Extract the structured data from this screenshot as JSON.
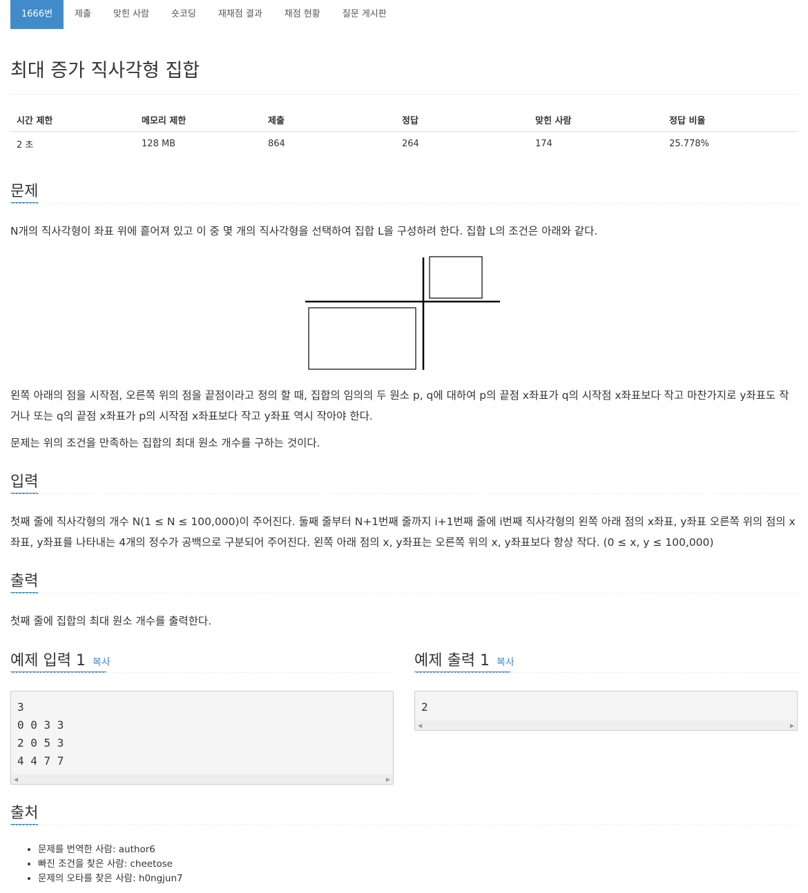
{
  "tabs": [
    {
      "label": "1666번",
      "active": true
    },
    {
      "label": "제출"
    },
    {
      "label": "맞힌 사람"
    },
    {
      "label": "숏코딩"
    },
    {
      "label": "재채점 결과"
    },
    {
      "label": "채점 현황"
    },
    {
      "label": "질문 게시판"
    }
  ],
  "problem_title": "최대 증가 직사각형 집합",
  "info": {
    "headers": [
      "시간 제한",
      "메모리 제한",
      "제출",
      "정답",
      "맞힌 사람",
      "정답 비율"
    ],
    "values": [
      "2 초",
      "128 MB",
      "864",
      "264",
      "174",
      "25.778%"
    ]
  },
  "sections": {
    "problem": {
      "heading": "문제",
      "p1": "N개의 직사각형이 좌표 위에 흩어져 있고 이 중 몇 개의 직사각형을 선택하여 집합 L을 구성하려 한다. 집합 L의 조건은 아래와 같다.",
      "p2": "왼쪽 아래의 점을 시작점, 오른쪽 위의 점을 끝점이라고 정의 할 때, 집합의 임의의 두 원소 p, q에 대하여 p의 끝점 x좌표가 q의 시작점 x좌표보다 작고 마찬가지로 y좌표도 작거나 또는 q의 끝점 x좌표가 p의 시작점 x좌표보다 작고 y좌표 역시 작아야 한다.",
      "p3": "문제는 위의 조건을 만족하는 집합의 최대 원소 개수를 구하는 것이다."
    },
    "input": {
      "heading": "입력",
      "text": "첫째 줄에 직사각형의 개수 N(1 ≤ N ≤ 100,000)이 주어진다. 둘째 줄부터 N+1번째 줄까지 i+1번째 줄에 i번째 직사각형의 왼쪽 아래 점의 x좌표, y좌표 오른쪽 위의 점의 x좌표, y좌표를 나타내는 4개의 정수가 공백으로 구분되어 주어진다. 왼쪽 아래 점의 x, y좌표는 오른쪽 위의 x, y좌표보다 항상 작다. (0 ≤ x, y ≤ 100,000)"
    },
    "output": {
      "heading": "출력",
      "text": "첫째 줄에 집합의 최대 원소 개수를 출력한다."
    },
    "sample_input": {
      "heading": "예제 입력 1",
      "copy": "복사",
      "content": "3\n0 0 3 3\n2 0 5 3\n4 4 7 7"
    },
    "sample_output": {
      "heading": "예제 출력 1",
      "copy": "복사",
      "content": "2"
    },
    "source": {
      "heading": "출처",
      "items": [
        "문제를 번역한 사람: author6",
        "빠진 조건을 찾은 사람: cheetose",
        "문제의 오타를 찾은 사람: h0ngjun7"
      ]
    }
  }
}
